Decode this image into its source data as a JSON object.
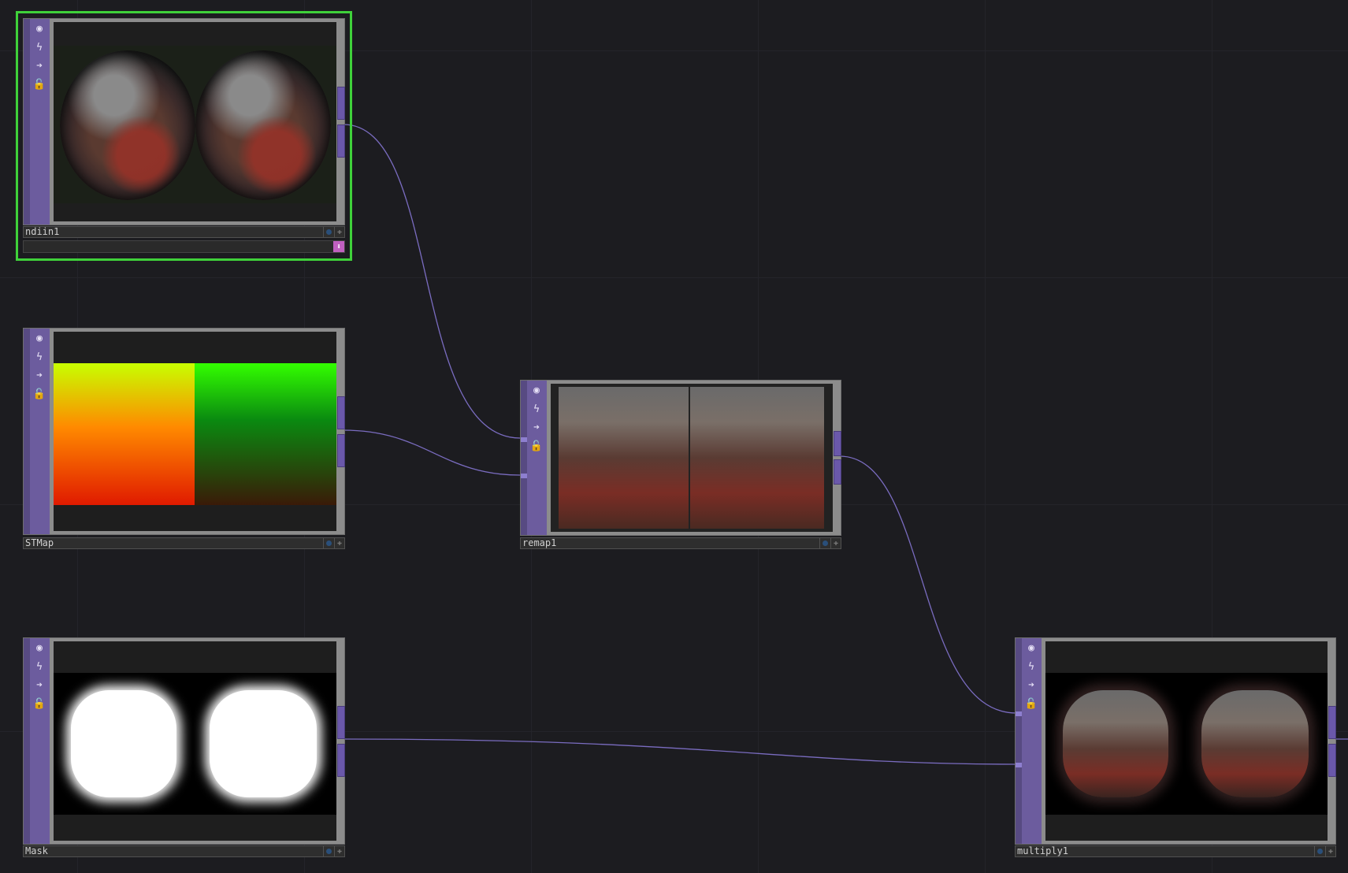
{
  "canvas": {
    "background": "#1c1c20",
    "wire_color": "#7a6cc0",
    "selected_color": "#3fd13a",
    "flag_bar_color": "#6c5c9e"
  },
  "nodes": {
    "ndiin1": {
      "name": "ndiin1",
      "selected": true
    },
    "stmap": {
      "name": "STMap",
      "selected": false
    },
    "remap1": {
      "name": "remap1",
      "selected": false
    },
    "mask": {
      "name": "Mask",
      "selected": false
    },
    "multiply1": {
      "name": "multiply1",
      "selected": false
    }
  },
  "flags": [
    "viewer-flag-icon",
    "bypass-flag-icon",
    "display-flag-icon",
    "lock-flag-icon"
  ],
  "wires": [
    {
      "from": "ndiin1",
      "to": "remap1"
    },
    {
      "from": "STMap",
      "to": "remap1"
    },
    {
      "from": "remap1",
      "to": "multiply1"
    },
    {
      "from": "Mask",
      "to": "multiply1"
    }
  ]
}
